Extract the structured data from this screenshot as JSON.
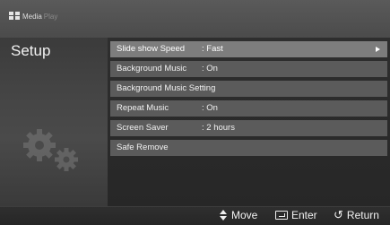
{
  "brand": {
    "name": "Media",
    "name_suffix": "Play"
  },
  "page": {
    "title": "Setup"
  },
  "menu": {
    "items": [
      {
        "label": "Slide show Speed",
        "value": ": Fast",
        "selected": true
      },
      {
        "label": "Background Music",
        "value": ": On"
      },
      {
        "label": "Background Music Setting",
        "value": ""
      },
      {
        "label": "Repeat Music",
        "value": ": On"
      },
      {
        "label": "Screen Saver",
        "value": ": 2 hours"
      },
      {
        "label": "Safe Remove",
        "value": ""
      }
    ]
  },
  "footer": {
    "move_label": "Move",
    "enter_label": "Enter",
    "return_label": "Return"
  },
  "icons": [
    "media-play-logo-icon",
    "gears-icon",
    "updown-arrow-icon",
    "enter-icon",
    "return-icon",
    "chevron-right-icon"
  ],
  "colors": {
    "background": "#2a2a2a",
    "menu_item": "#5b5b5b",
    "menu_item_selected": "#7d7d7d",
    "text": "#f0f0f0"
  }
}
